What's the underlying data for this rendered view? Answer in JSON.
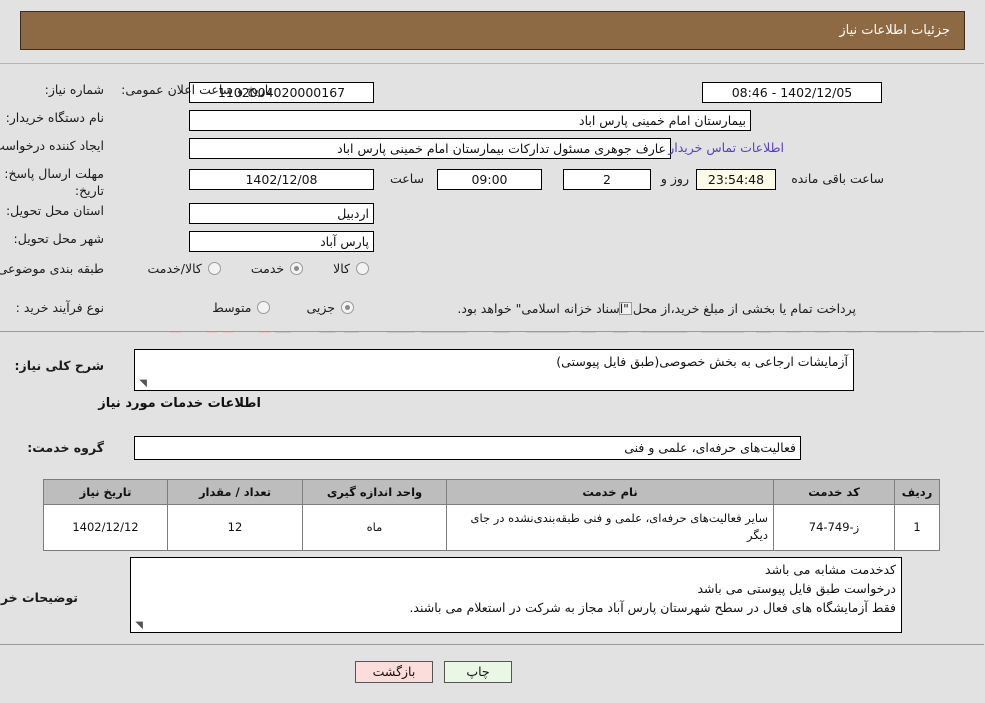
{
  "header": {
    "title": "جزئیات اطلاعات نیاز"
  },
  "watermark": {
    "text": "ArtaTender",
    "suffix": ".net"
  },
  "form": {
    "need_number_label": "شماره نیاز:",
    "need_number_value": "1102004020000167",
    "announce_label": "تاریخ و ساعت اعلان عمومی:",
    "announce_value": "1402/12/05 - 08:46",
    "buyer_org_label": "نام دستگاه خریدار:",
    "buyer_org_value": "بیمارستان امام خمینی پارس اباد",
    "creator_label": "ایجاد کننده درخواست:",
    "creator_value": "عارف جوهری مسئول تدارکات بیمارستان امام خمینی پارس اباد",
    "contact_link": "اطلاعات تماس خریدار",
    "deadline_label_line1": "مهلت ارسال پاسخ: تا",
    "deadline_label_line2": "تاریخ:",
    "deadline_date": "1402/12/08",
    "hour_label": "ساعت",
    "hour_value": "09:00",
    "days_value": "2",
    "days_label": "روز و",
    "countdown_value": "23:54:48",
    "countdown_label": "ساعت باقی مانده",
    "province_label": "استان محل تحویل:",
    "province_value": "اردبیل",
    "city_label": "شهر محل تحویل:",
    "city_value": "پارس آباد",
    "category_label": "طبقه بندی موضوعی:",
    "category_options": [
      {
        "label": "کالا",
        "selected": false
      },
      {
        "label": "خدمت",
        "selected": true
      },
      {
        "label": "کالا/خدمت",
        "selected": false
      }
    ],
    "process_label": "نوع فرآیند خرید :",
    "process_options": [
      {
        "label": "جزیی",
        "selected": true
      },
      {
        "label": "متوسط",
        "selected": false
      }
    ],
    "treasury_checkbox_label": "پرداخت تمام یا بخشی از مبلغ خرید،از محل \"اسناد خزانه اسلامی\" خواهد بود.",
    "treasury_checked": false
  },
  "need_desc": {
    "label": "شرح کلی نیاز:",
    "value": "آزمایشات ارجاعی به بخش خصوصی(طبق فایل پیوستی)"
  },
  "services_section": {
    "title": "اطلاعات خدمات مورد نیاز",
    "group_label": "گروه خدمت:",
    "group_value": "فعالیت‌های حرفه‌ای، علمی و فنی"
  },
  "table": {
    "columns": [
      "ردیف",
      "کد خدمت",
      "نام خدمت",
      "واحد اندازه گیری",
      "تعداد / مقدار",
      "تاریخ نیاز"
    ],
    "rows": [
      {
        "row_no": "1",
        "service_code": "ز-749-74",
        "service_name": "سایر فعالیت‌های حرفه‌ای، علمی و فنی طبقه‌بندی‌نشده در جای دیگر",
        "unit": "ماه",
        "quantity": "12",
        "need_date": "1402/12/12"
      }
    ]
  },
  "buyer_notes": {
    "label": "توضیحات خریدار:",
    "lines": [
      "کدخدمت مشابه می باشد",
      "درخواست طبق فایل پیوستی می باشد",
      "فقط آزمایشگاه های فعال در سطح شهرستان پارس آباد مجاز به شرکت در استعلام می باشند."
    ]
  },
  "buttons": {
    "print": "چاپ",
    "back": "بازگشت"
  }
}
